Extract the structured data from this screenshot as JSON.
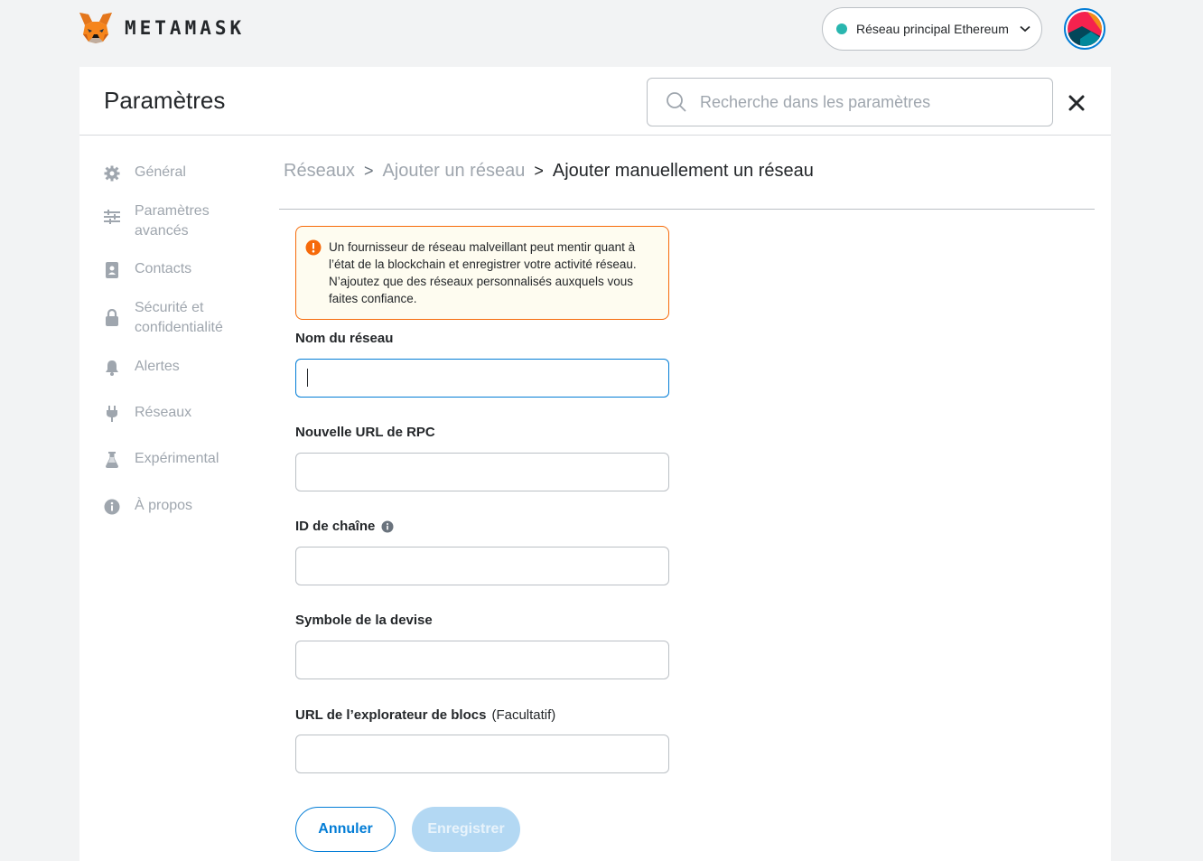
{
  "app": {
    "wordmark": "METAMASK",
    "network": "Réseau principal Ethereum",
    "network_color": "#29b6af",
    "accent": "#037dd6"
  },
  "header": {
    "title": "Paramètres",
    "search_placeholder": "Recherche dans les paramètres"
  },
  "sidebar": {
    "items": [
      {
        "label": "Général",
        "icon": "gear-icon"
      },
      {
        "label": "Paramètres\navancés",
        "icon": "sliders-icon"
      },
      {
        "label": "Contacts",
        "icon": "address-book-icon"
      },
      {
        "label": "Sécurité et\nconfidentialité",
        "icon": "lock-icon"
      },
      {
        "label": "Alertes",
        "icon": "bell-icon"
      },
      {
        "label": "Réseaux",
        "icon": "plug-icon"
      },
      {
        "label": "Expérimental",
        "icon": "flask-icon"
      },
      {
        "label": "À propos",
        "icon": "info-icon"
      }
    ]
  },
  "breadcrumb": {
    "networks": "Réseaux",
    "add_network": "Ajouter un réseau",
    "current": "Ajouter manuellement un réseau",
    "separator": ">"
  },
  "warning": {
    "text": "Un fournisseur de réseau malveillant peut mentir quant à l’état de la blockchain et enregistrer votre activité réseau. N’ajoutez que des réseaux personnalisés auxquels vous faites confiance."
  },
  "form": {
    "network_name_label": "Nom du réseau",
    "rpc_url_label": "Nouvelle URL de RPC",
    "chain_id_label": "ID de chaîne",
    "currency_symbol_label": "Symbole de la devise",
    "explorer_url_label": "URL de l’explorateur de blocs",
    "explorer_optional": "(Facultatif)",
    "network_name_value": "",
    "rpc_url_value": "",
    "chain_id_value": "",
    "currency_symbol_value": "",
    "explorer_url_value": ""
  },
  "buttons": {
    "cancel": "Annuler",
    "save": "Enregistrer"
  }
}
